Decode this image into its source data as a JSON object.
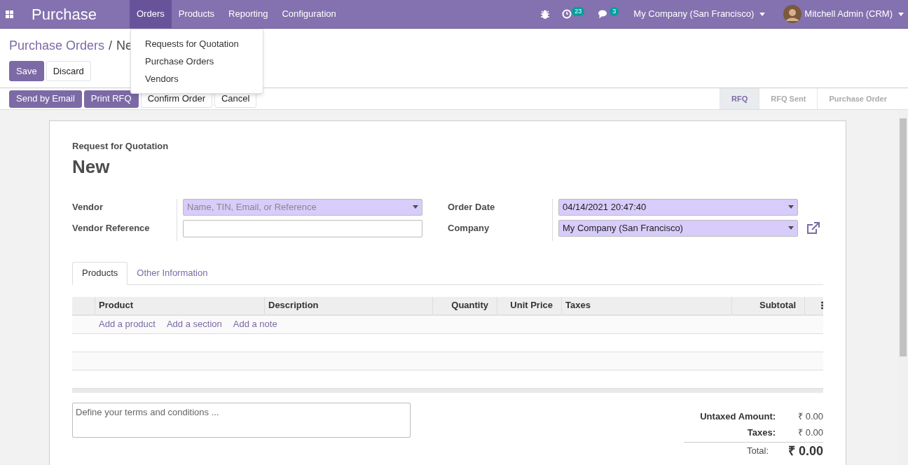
{
  "navbar": {
    "app_title": "Purchase",
    "menu": [
      {
        "label": "Orders",
        "selected": true
      },
      {
        "label": "Products",
        "selected": false
      },
      {
        "label": "Reporting",
        "selected": false
      },
      {
        "label": "Configuration",
        "selected": false
      }
    ],
    "activity_count": "23",
    "message_count": "3",
    "company": "My Company (San Francisco)",
    "user": "Mitchell Admin (CRM)"
  },
  "dropdown": [
    "Requests for Quotation",
    "Purchase Orders",
    "Vendors"
  ],
  "breadcrumb": {
    "parent": "Purchase Orders",
    "separator": "/",
    "current": "Ne"
  },
  "edit_buttons": [
    {
      "label": "Save",
      "kind": "primary"
    },
    {
      "label": "Discard",
      "kind": "secondary"
    }
  ],
  "action_buttons": [
    {
      "label": "Send by Email",
      "kind": "primary"
    },
    {
      "label": "Print RFQ",
      "kind": "primary"
    },
    {
      "label": "Confirm Order",
      "kind": "secondary"
    },
    {
      "label": "Cancel",
      "kind": "secondary"
    }
  ],
  "status_steps": [
    {
      "label": "RFQ",
      "selected": true
    },
    {
      "label": "RFQ Sent",
      "selected": false
    },
    {
      "label": "Purchase Order",
      "selected": false
    }
  ],
  "form": {
    "subtitle": "Request for Quotation",
    "title": "New",
    "left_fields": [
      {
        "label": "Vendor",
        "kind": "select",
        "placeholder": "Name, TIN, Email, or Reference"
      },
      {
        "label": "Vendor Reference",
        "kind": "text"
      }
    ],
    "right_fields": [
      {
        "label": "Order Date",
        "kind": "select",
        "value": "04/14/2021 20:47:40"
      },
      {
        "label": "Company",
        "kind": "select",
        "value": "My Company (San Francisco)",
        "external_link": true
      }
    ],
    "tabs": [
      {
        "label": "Products",
        "selected": true
      },
      {
        "label": "Other Information",
        "selected": false
      }
    ],
    "columns": [
      {
        "label": "Product",
        "kind": "text"
      },
      {
        "label": "Description",
        "kind": "text"
      },
      {
        "label": "Quantity",
        "kind": "number"
      },
      {
        "label": "Unit Price",
        "kind": "number"
      },
      {
        "label": "Taxes",
        "kind": "text"
      },
      {
        "label": "Subtotal",
        "kind": "number"
      }
    ],
    "add_links": [
      "Add a product",
      "Add a section",
      "Add a note"
    ],
    "terms_placeholder": "Define your terms and conditions ...",
    "totals": [
      {
        "label": "Untaxed Amount:",
        "value": "₹ 0.00",
        "kind": "line"
      },
      {
        "label": "Taxes:",
        "value": "₹ 0.00",
        "kind": "line"
      },
      {
        "label": "Total:",
        "value": "₹ 0.00",
        "kind": "total"
      }
    ]
  }
}
